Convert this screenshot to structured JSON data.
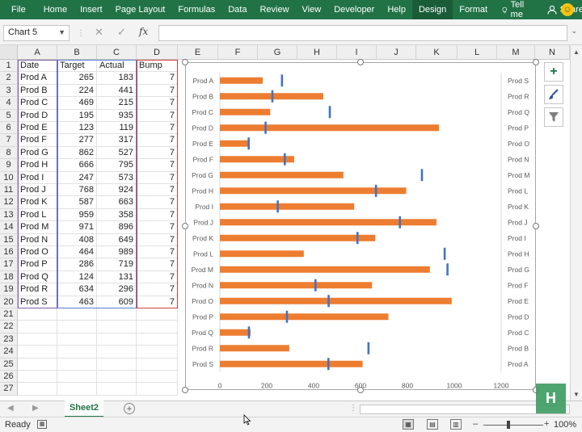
{
  "ribbon": {
    "tabs": [
      "File",
      "Home",
      "Insert",
      "Page Layout",
      "Formulas",
      "Data",
      "Review",
      "View",
      "Developer",
      "Help",
      "Design",
      "Format"
    ],
    "tell_me": "Tell me",
    "share": "Share"
  },
  "formula_bar": {
    "name_box": "Chart 5",
    "fx": "fx",
    "formula": ""
  },
  "columns": [
    "A",
    "B",
    "C",
    "D",
    "E",
    "F",
    "G",
    "H",
    "I",
    "J",
    "K",
    "L",
    "M",
    "N"
  ],
  "rows": [
    "1",
    "2",
    "3",
    "4",
    "5",
    "6",
    "7",
    "8",
    "9",
    "10",
    "11",
    "12",
    "13",
    "14",
    "15",
    "16",
    "17",
    "18",
    "19",
    "20",
    "21",
    "22",
    "23",
    "24",
    "25",
    "26",
    "27"
  ],
  "table": {
    "headers": [
      "Date",
      "Target",
      "Actual",
      "Bump"
    ],
    "rows": [
      [
        "Prod A",
        "265",
        "183",
        "7"
      ],
      [
        "Prod B",
        "224",
        "441",
        "7"
      ],
      [
        "Prod C",
        "469",
        "215",
        "7"
      ],
      [
        "Prod D",
        "195",
        "935",
        "7"
      ],
      [
        "Prod E",
        "123",
        "119",
        "7"
      ],
      [
        "Prod F",
        "277",
        "317",
        "7"
      ],
      [
        "Prod G",
        "862",
        "527",
        "7"
      ],
      [
        "Prod H",
        "666",
        "795",
        "7"
      ],
      [
        "Prod I",
        "247",
        "573",
        "7"
      ],
      [
        "Prod J",
        "768",
        "924",
        "7"
      ],
      [
        "Prod K",
        "587",
        "663",
        "7"
      ],
      [
        "Prod L",
        "959",
        "358",
        "7"
      ],
      [
        "Prod M",
        "971",
        "896",
        "7"
      ],
      [
        "Prod N",
        "408",
        "649",
        "7"
      ],
      [
        "Prod O",
        "464",
        "989",
        "7"
      ],
      [
        "Prod P",
        "286",
        "719",
        "7"
      ],
      [
        "Prod Q",
        "124",
        "131",
        "7"
      ],
      [
        "Prod R",
        "634",
        "296",
        "7"
      ],
      [
        "Prod S",
        "463",
        "609",
        "7"
      ]
    ]
  },
  "chart_data": {
    "type": "bar",
    "orientation": "horizontal",
    "categories": [
      "Prod A",
      "Prod B",
      "Prod C",
      "Prod D",
      "Prod E",
      "Prod F",
      "Prod G",
      "Prod H",
      "Prod I",
      "Prod J",
      "Prod K",
      "Prod L",
      "Prod M",
      "Prod N",
      "Prod O",
      "Prod P",
      "Prod Q",
      "Prod R",
      "Prod S"
    ],
    "secondary_categories": [
      "Prod S",
      "Prod R",
      "Prod Q",
      "Prod P",
      "Prod O",
      "Prod N",
      "Prod M",
      "Prod L",
      "Prod K",
      "Prod J",
      "Prod I",
      "Prod H",
      "Prod G",
      "Prod F",
      "Prod E",
      "Prod D",
      "Prod C",
      "Prod B",
      "Prod A"
    ],
    "series": [
      {
        "values": [
          183,
          441,
          215,
          935,
          119,
          317,
          527,
          795,
          573,
          924,
          663,
          358,
          896,
          649,
          989,
          719,
          131,
          296,
          609
        ],
        "color": "#ed7d31",
        "style": "bar"
      },
      {
        "values": [
          265,
          224,
          469,
          195,
          123,
          277,
          862,
          666,
          247,
          768,
          587,
          959,
          971,
          408,
          464,
          286,
          124,
          634,
          463
        ],
        "color": "#4472c4",
        "style": "marker"
      }
    ],
    "xlim": [
      0,
      1200
    ],
    "xticks": [
      "0",
      "200",
      "400",
      "600",
      "800",
      "1000",
      "1200"
    ],
    "xtick_values": [
      0,
      200,
      400,
      600,
      800,
      1000,
      1200
    ],
    "title": "",
    "grid": false,
    "legend": "none"
  },
  "sheet_tabs": [
    "Sheet2"
  ],
  "status": {
    "ready": "Ready",
    "zoom": "100%"
  },
  "colors": {
    "excel_green": "#217346",
    "bar": "#ed7d31",
    "marker": "#4472c4"
  },
  "icons": {
    "chart_elements": "plus-icon",
    "chart_styles": "brush-icon",
    "chart_filters": "filter-icon"
  }
}
